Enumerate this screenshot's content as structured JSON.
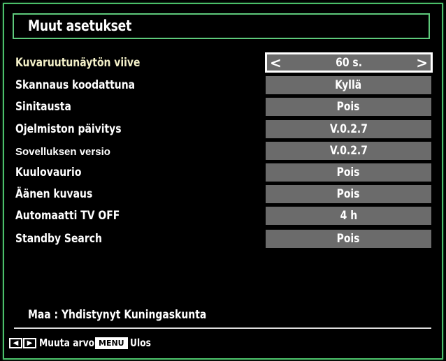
{
  "title": "Muut asetukset",
  "settings": [
    {
      "label": "Kuvaruutunäytön viive",
      "value": "60 s.",
      "selected": true
    },
    {
      "label": "Skannaus koodattuna",
      "value": "Kyllä"
    },
    {
      "label": "Sinitausta",
      "value": "Pois"
    },
    {
      "label": "Ojelmiston päivitys",
      "value": "V.0.2.7"
    },
    {
      "label": "Sovelluksen versio",
      "value": "V.0.2.7"
    },
    {
      "label": "Kuulovaurio",
      "value": "Pois"
    },
    {
      "label": "Äänen kuvaus",
      "value": "Pois"
    },
    {
      "label": "Automaatti TV OFF",
      "value": "4 h"
    },
    {
      "label": "Standby Search",
      "value": "Pois"
    }
  ],
  "arrows": {
    "left": "<",
    "right": ">"
  },
  "country": "Maa : Yhdistynyt Kuningaskunta",
  "footer": {
    "left_key": "◀",
    "right_key": "▶",
    "change_label": "Muuta arvo",
    "menu_key": "MENU",
    "exit_label": "Ulos"
  },
  "colors": {
    "border": "#4bbf6a",
    "value_bg": "#6b6b6b",
    "selected_label": "#f4f1c9"
  }
}
